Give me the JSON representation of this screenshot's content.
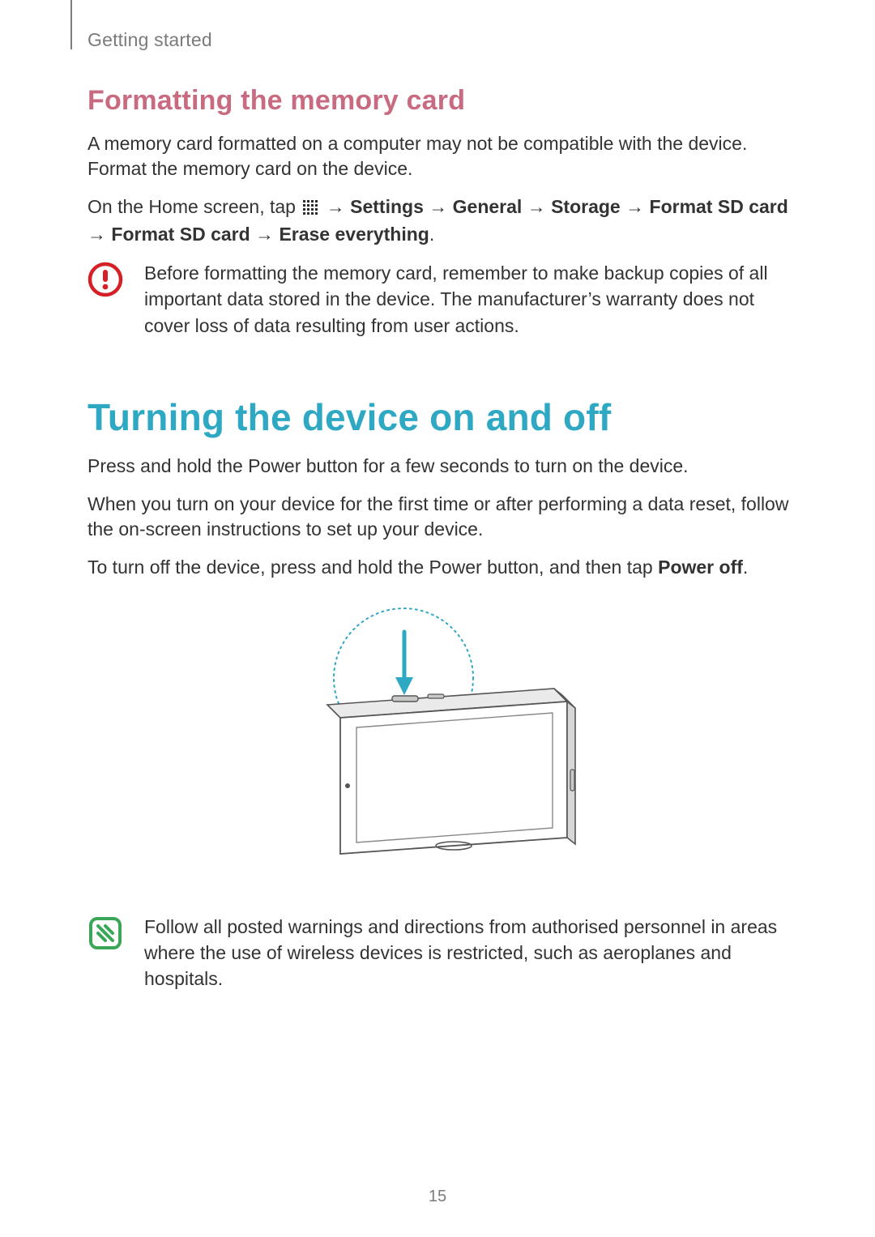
{
  "header": {
    "section_label": "Getting started"
  },
  "section1": {
    "heading": "Formatting the memory card",
    "para1": "A memory card formatted on a computer may not be compatible with the device. Format the memory card on the device.",
    "path_intro": "On the Home screen, tap ",
    "path_settings": "Settings",
    "path_general": "General",
    "path_storage": "Storage",
    "path_format1": "Format SD card",
    "path_format2": "Format SD card",
    "path_erase": "Erase everything",
    "arrow": " → ",
    "period": ".",
    "warning": "Before formatting the memory card, remember to make backup copies of all important data stored in the device. The manufacturer’s warranty does not cover loss of data resulting from user actions."
  },
  "section2": {
    "heading": "Turning the device on and off",
    "para1": "Press and hold the Power button for a few seconds to turn on the device.",
    "para2": "When you turn on your device for the first time or after performing a data reset, follow the on-screen instructions to set up your device.",
    "para3_pre": "To turn off the device, press and hold the Power button, and then tap ",
    "para3_bold": "Power off",
    "para3_post": ".",
    "note": "Follow all posted warnings and directions from authorised personnel in areas where the use of wireless devices is restricted, such as aeroplanes and hospitals."
  },
  "page_number": "15"
}
